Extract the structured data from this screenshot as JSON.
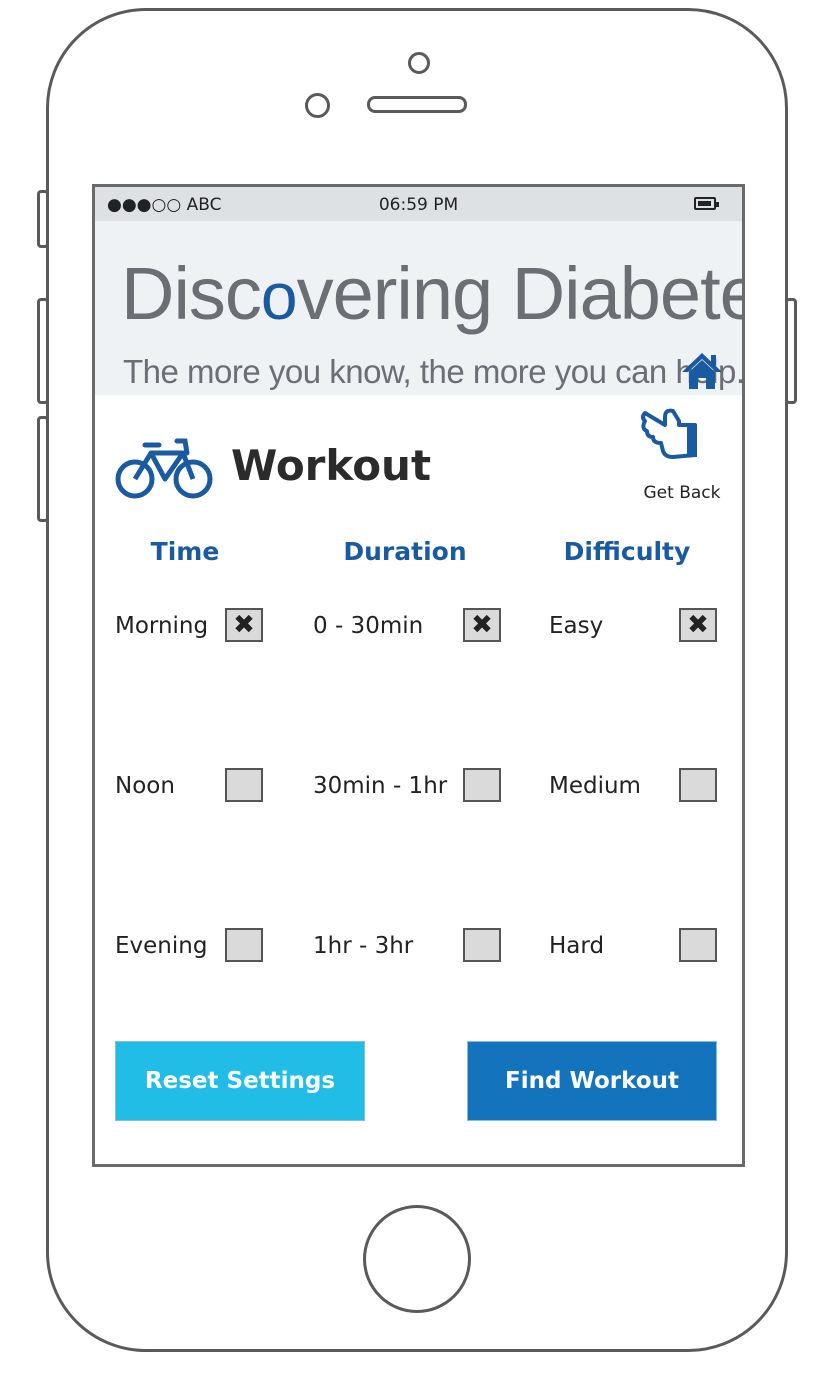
{
  "statusbar": {
    "carrier": "●●●○○ ABC",
    "time": "06:59 PM"
  },
  "banner": {
    "title_part1": "Disc",
    "title_part2": "o",
    "title_part3": "vering Diabetes",
    "tagline": "The more you know, the more you can help."
  },
  "header": {
    "title": "Workout",
    "back_label": "Get Back"
  },
  "columns": {
    "time": {
      "label": "Time",
      "options": [
        "Morning",
        "Noon",
        "Evening"
      ]
    },
    "duration": {
      "label": "Duration",
      "options": [
        "0 - 30min",
        "30min - 1hr",
        "1hr - 3hr"
      ]
    },
    "difficulty": {
      "label": "Difficulty",
      "options": [
        "Easy",
        "Medium",
        "Hard"
      ]
    }
  },
  "checked_mark": "✖",
  "buttons": {
    "reset": "Reset Settings",
    "find": "Find Workout"
  },
  "colors": {
    "accent": "#1a5aa0",
    "reset_button": "#22bde6",
    "find_button": "#1473bd"
  }
}
